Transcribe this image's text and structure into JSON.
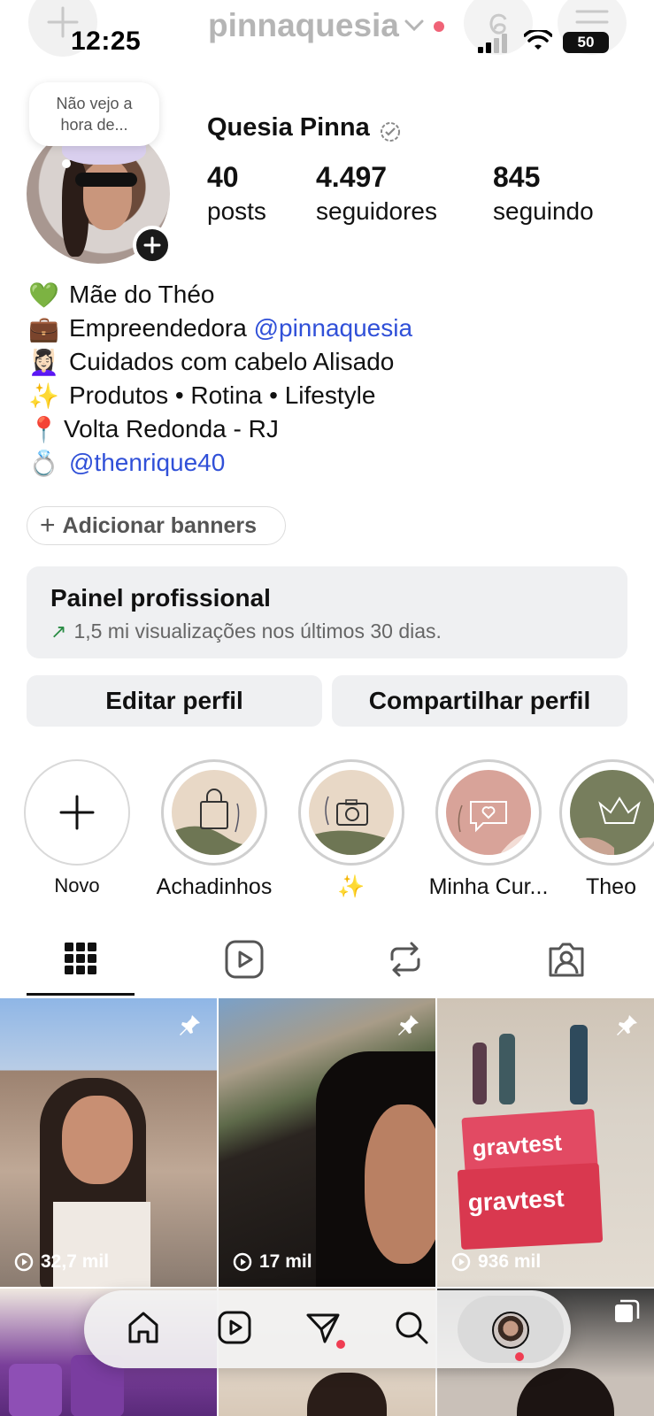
{
  "status_bar": {
    "time": "12:25",
    "battery": "50"
  },
  "header": {
    "username": "pinnaquesia"
  },
  "note": {
    "text_line1": "Não vejo a",
    "text_line2": "hora de..."
  },
  "profile": {
    "full_name": "Quesia Pinna",
    "stats": [
      {
        "value": "40",
        "label": "posts"
      },
      {
        "value": "4.497",
        "label": "seguidores"
      },
      {
        "value": "845",
        "label": "seguindo"
      }
    ]
  },
  "bio": {
    "lines": [
      {
        "emoji": "💚",
        "text": "Mãe do Théo",
        "mention": ""
      },
      {
        "emoji": "💼",
        "text": "Empreendedora ",
        "mention": "@pinnaquesia"
      },
      {
        "emoji": "💆🏻‍♀️",
        "text": "Cuidados com cabelo Alisado",
        "mention": ""
      },
      {
        "emoji": "✨",
        "text": "Produtos • Rotina • Lifestyle",
        "mention": ""
      },
      {
        "emoji": "📍",
        "text": "Volta Redonda - RJ",
        "mention": ""
      },
      {
        "emoji": "💍",
        "text": "",
        "mention": "@thenrique40"
      }
    ]
  },
  "banner_button": {
    "label": "Adicionar banners"
  },
  "dashboard": {
    "title": "Painel profissional",
    "subtitle": "1,5 mi visualizações nos últimos 30 dias."
  },
  "actions": {
    "edit": "Editar perfil",
    "share": "Compartilhar perfil"
  },
  "highlights": [
    {
      "label": "Novo",
      "icon": "plus-icon"
    },
    {
      "label": "Achadinhos",
      "icon": "shopping-bag-icon"
    },
    {
      "label": "✨",
      "icon": "camera-icon"
    },
    {
      "label": "Minha Cur...",
      "icon": "heart-chat-icon"
    },
    {
      "label": "Theo",
      "icon": "crown-icon"
    }
  ],
  "tabs": [
    "grid-icon",
    "reels-icon",
    "reposts-icon",
    "tagged-icon"
  ],
  "posts": [
    {
      "views": "32,7 mil",
      "pinned": true
    },
    {
      "views": "17 mil",
      "pinned": true
    },
    {
      "views": "936 mil",
      "pinned": true
    },
    {
      "views": "",
      "pinned": false
    },
    {
      "views": "",
      "pinned": false
    },
    {
      "views": "",
      "pinned": false
    }
  ],
  "colors": {
    "mention": "#3050d8",
    "button_bg": "#eff0f2",
    "notification": "#ef3d52"
  }
}
